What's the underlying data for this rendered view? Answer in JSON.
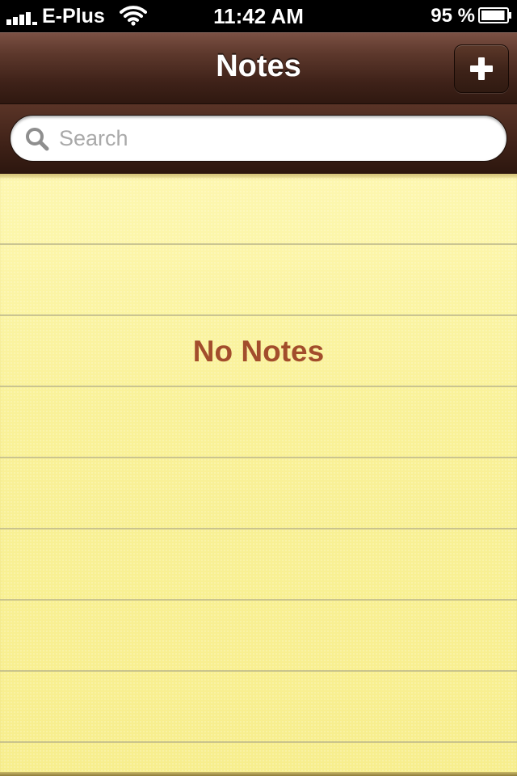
{
  "status_bar": {
    "carrier": "E-Plus",
    "time": "11:42 AM",
    "battery_percent": "95 %",
    "battery_level": 0.95,
    "signal_icon": "signal-bars-icon",
    "wifi_icon": "wifi-icon",
    "battery_icon": "battery-icon"
  },
  "nav_bar": {
    "title": "Notes",
    "add_icon": "plus-icon"
  },
  "search": {
    "placeholder": "Search",
    "value": "",
    "icon": "magnifier-icon"
  },
  "content": {
    "empty_message": "No Notes"
  },
  "colors": {
    "leather_dark": "#2f1810",
    "leather_light": "#7c5144",
    "paper_yellow": "#faf39a",
    "empty_text": "#a24d2c",
    "rule_line": "#b9b48a"
  }
}
